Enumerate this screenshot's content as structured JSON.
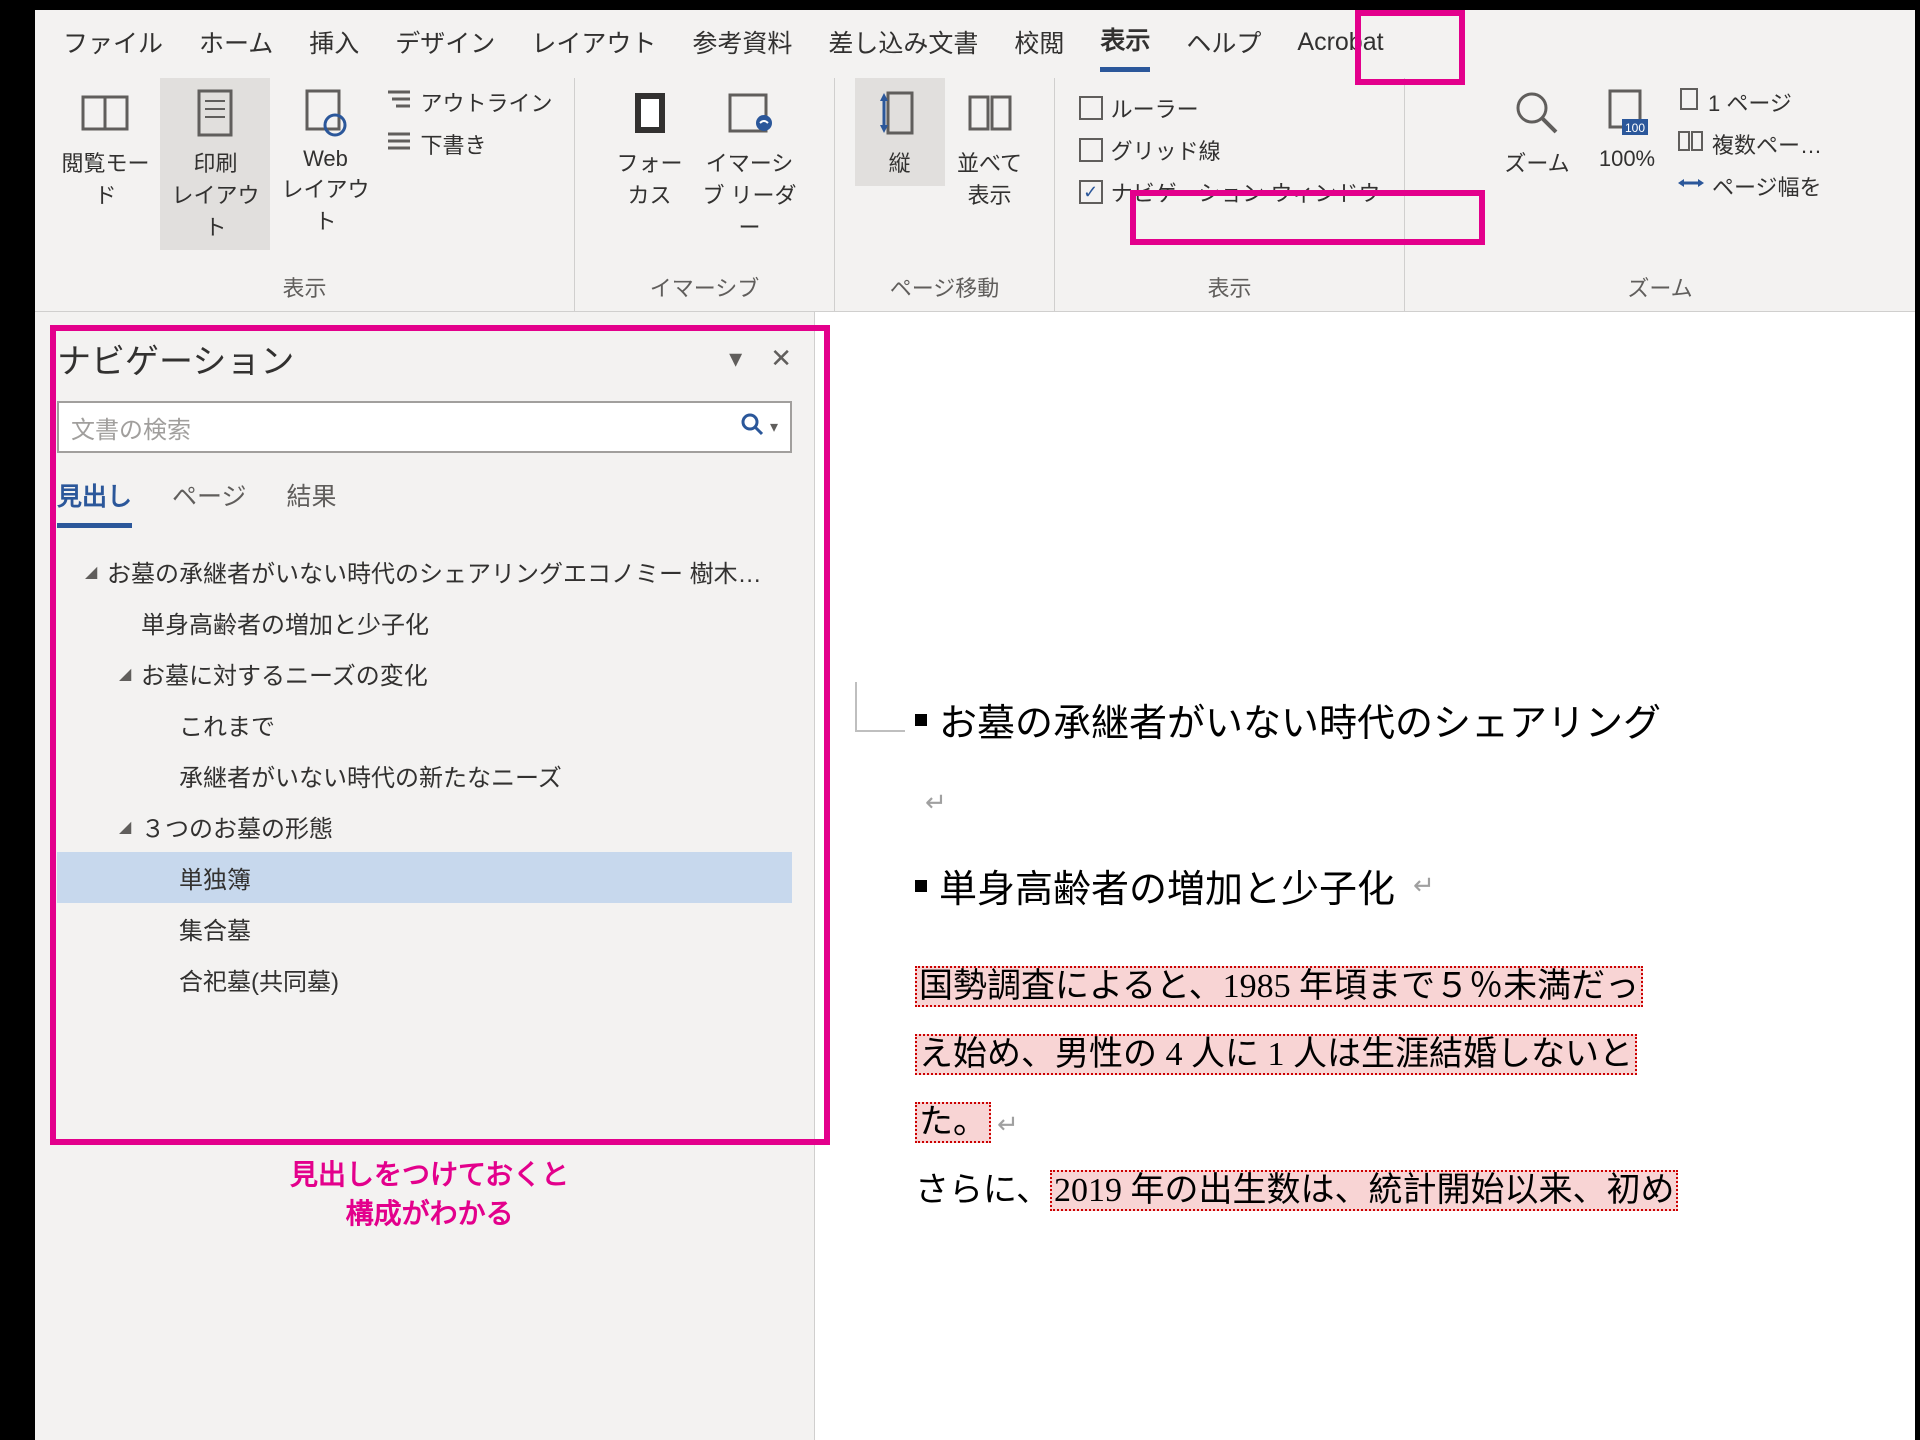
{
  "tabs": {
    "file": "ファイル",
    "home": "ホーム",
    "insert": "挿入",
    "design": "デザイン",
    "layout": "レイアウト",
    "references": "参考資料",
    "mailings": "差し込み文書",
    "review": "校閲",
    "view": "表示",
    "help": "ヘルプ",
    "acrobat": "Acrobat"
  },
  "ribbon": {
    "views": {
      "read": "閲覧モード",
      "print": "印刷\nレイアウト",
      "web": "Web\nレイアウト",
      "outline": "アウトライン",
      "draft": "下書き",
      "group": "表示"
    },
    "immersive": {
      "focus": "フォー\nカス",
      "reader": "イマーシ\nブ リーダー",
      "group": "イマーシブ"
    },
    "pagemove": {
      "vertical": "縦",
      "side": "並べて\n表示",
      "group": "ページ移動"
    },
    "show": {
      "ruler": "ルーラー",
      "grid": "グリッド線",
      "nav": "ナビゲーション ウィンドウ",
      "group": "表示"
    },
    "zoom": {
      "zoom": "ズーム",
      "hundred": "100%",
      "one": "1 ページ",
      "multi": "複数ペー…",
      "width": "ページ幅を",
      "group": "ズーム"
    }
  },
  "navpane": {
    "title": "ナビゲーション",
    "search_placeholder": "文書の検索",
    "tabs": {
      "headings": "見出し",
      "pages": "ページ",
      "results": "結果"
    },
    "tree": {
      "n0": "お墓の承継者がいない時代のシェアリングエコノミー 樹木…",
      "n1": "単身高齢者の増加と少子化",
      "n2": "お墓に対するニーズの変化",
      "n3": "これまで",
      "n4": "承継者がいない時代の新たなニーズ",
      "n5": "３つのお墓の形態",
      "n6": "単独簿",
      "n7": "集合墓",
      "n8": "合祀墓(共同墓)"
    }
  },
  "annotation": {
    "line1": "見出しをつけておくと",
    "line2": "構成がわかる"
  },
  "document": {
    "h1": "お墓の承継者がいない時代のシェアリング",
    "h2": "単身高齢者の増加と少子化",
    "p1a": "国勢調査によると、1985 年頃まで５％未満だっ",
    "p1b": "え始め、男性の 4 人に 1 人は生涯結婚しないと",
    "p1c": "た。",
    "p2a": "さらに、",
    "p2b": "2019 年の出生数は、統計開始以来、初め"
  }
}
